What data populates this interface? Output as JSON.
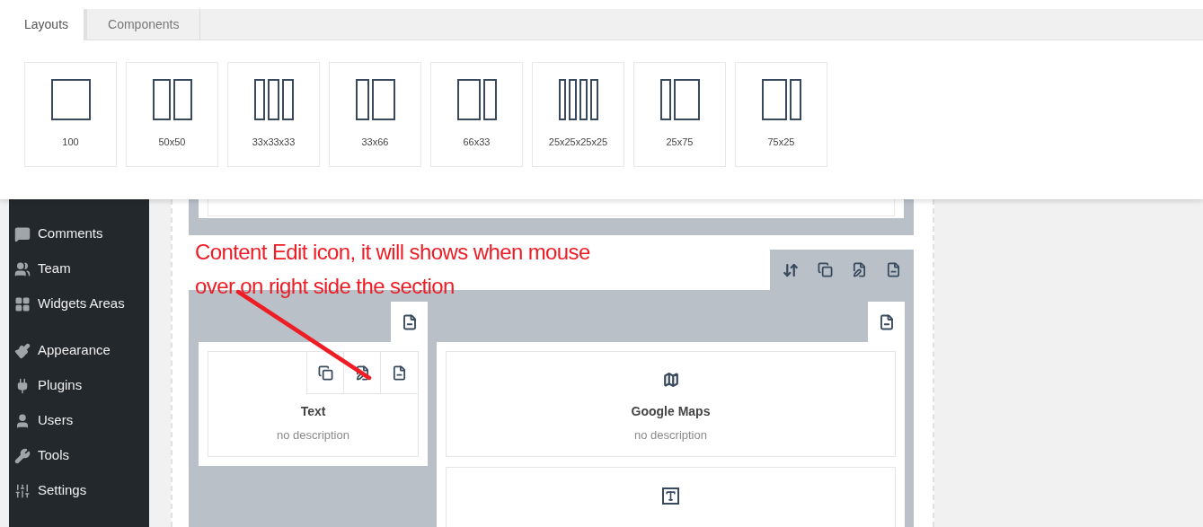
{
  "tabs": [
    {
      "label": "Layouts",
      "selected": true
    },
    {
      "label": "Components",
      "selected": false
    }
  ],
  "layouts": [
    {
      "label": "100"
    },
    {
      "label": "50x50"
    },
    {
      "label": "33x33x33"
    },
    {
      "label": "33x66"
    },
    {
      "label": "66x33"
    },
    {
      "label": "25x25x25x25"
    },
    {
      "label": "25x75"
    },
    {
      "label": "75x25"
    }
  ],
  "sidebar": {
    "items": [
      {
        "label": "Comments"
      },
      {
        "label": "Team"
      },
      {
        "label": "Widgets Areas"
      },
      {
        "label": "Appearance"
      },
      {
        "label": "Plugins"
      },
      {
        "label": "Users"
      },
      {
        "label": "Tools"
      },
      {
        "label": "Settings"
      }
    ]
  },
  "annotation": {
    "lines": [
      "Content Edit icon, it will shows when mouse",
      "over on right side the section"
    ]
  },
  "section": {
    "columns": [
      {
        "elements": [
          {
            "kind": "text",
            "title": "Text",
            "description": "no description",
            "hovered": true
          }
        ]
      },
      {
        "elements": [
          {
            "kind": "map",
            "title": "Google Maps",
            "description": "no description",
            "hovered": false
          },
          {
            "kind": "text",
            "hovered": false
          }
        ]
      }
    ]
  }
}
